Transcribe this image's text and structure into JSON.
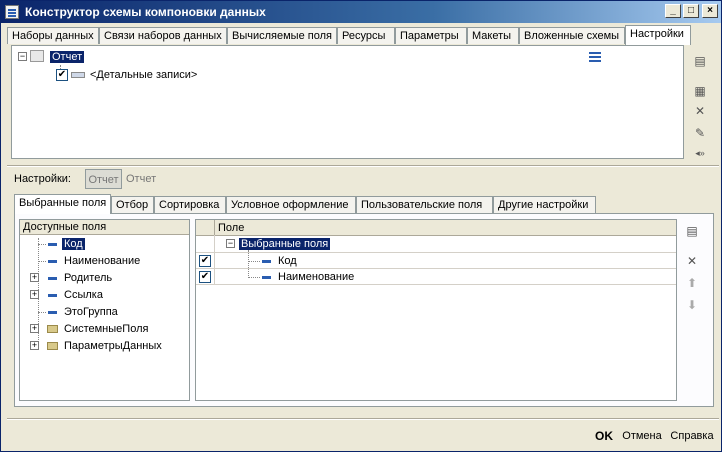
{
  "window": {
    "title": "Конструктор схемы компоновки данных"
  },
  "top_tabs": [
    "Наборы данных",
    "Связи наборов данных",
    "Вычисляемые поля",
    "Ресурсы",
    "Параметры",
    "Макеты",
    "Вложенные схемы",
    "Настройки"
  ],
  "structure_tree": {
    "root": "Отчет",
    "child": "<Детальные записи>",
    "child_checked": true
  },
  "settings": {
    "label": "Настройки:",
    "btn_report": "Отчет",
    "value": "Отчет"
  },
  "sub_tabs": [
    "Выбранные поля",
    "Отбор",
    "Сортировка",
    "Условное оформление",
    "Пользовательские поля",
    "Другие настройки"
  ],
  "available_fields": {
    "header": "Доступные поля",
    "items": [
      {
        "label": "Код",
        "icon": "field-icon",
        "expandable": false,
        "selected": true
      },
      {
        "label": "Наименование",
        "icon": "field-icon",
        "expandable": false,
        "selected": false
      },
      {
        "label": "Родитель",
        "icon": "field-icon",
        "expandable": true,
        "selected": false
      },
      {
        "label": "Ссылка",
        "icon": "field-icon",
        "expandable": true,
        "selected": false
      },
      {
        "label": "ЭтоГруппа",
        "icon": "field-icon",
        "expandable": false,
        "selected": false
      },
      {
        "label": "СистемныеПоля",
        "icon": "folder-icon",
        "expandable": true,
        "selected": false
      },
      {
        "label": "ПараметрыДанных",
        "icon": "folder-icon",
        "expandable": true,
        "selected": false
      }
    ]
  },
  "selected_fields": {
    "header": "Поле",
    "group": "Выбранные поля",
    "items": [
      {
        "label": "Код",
        "checked": true
      },
      {
        "label": "Наименование",
        "checked": true
      }
    ]
  },
  "footer": {
    "ok": "OK",
    "cancel": "Отмена",
    "help": "Справка"
  }
}
